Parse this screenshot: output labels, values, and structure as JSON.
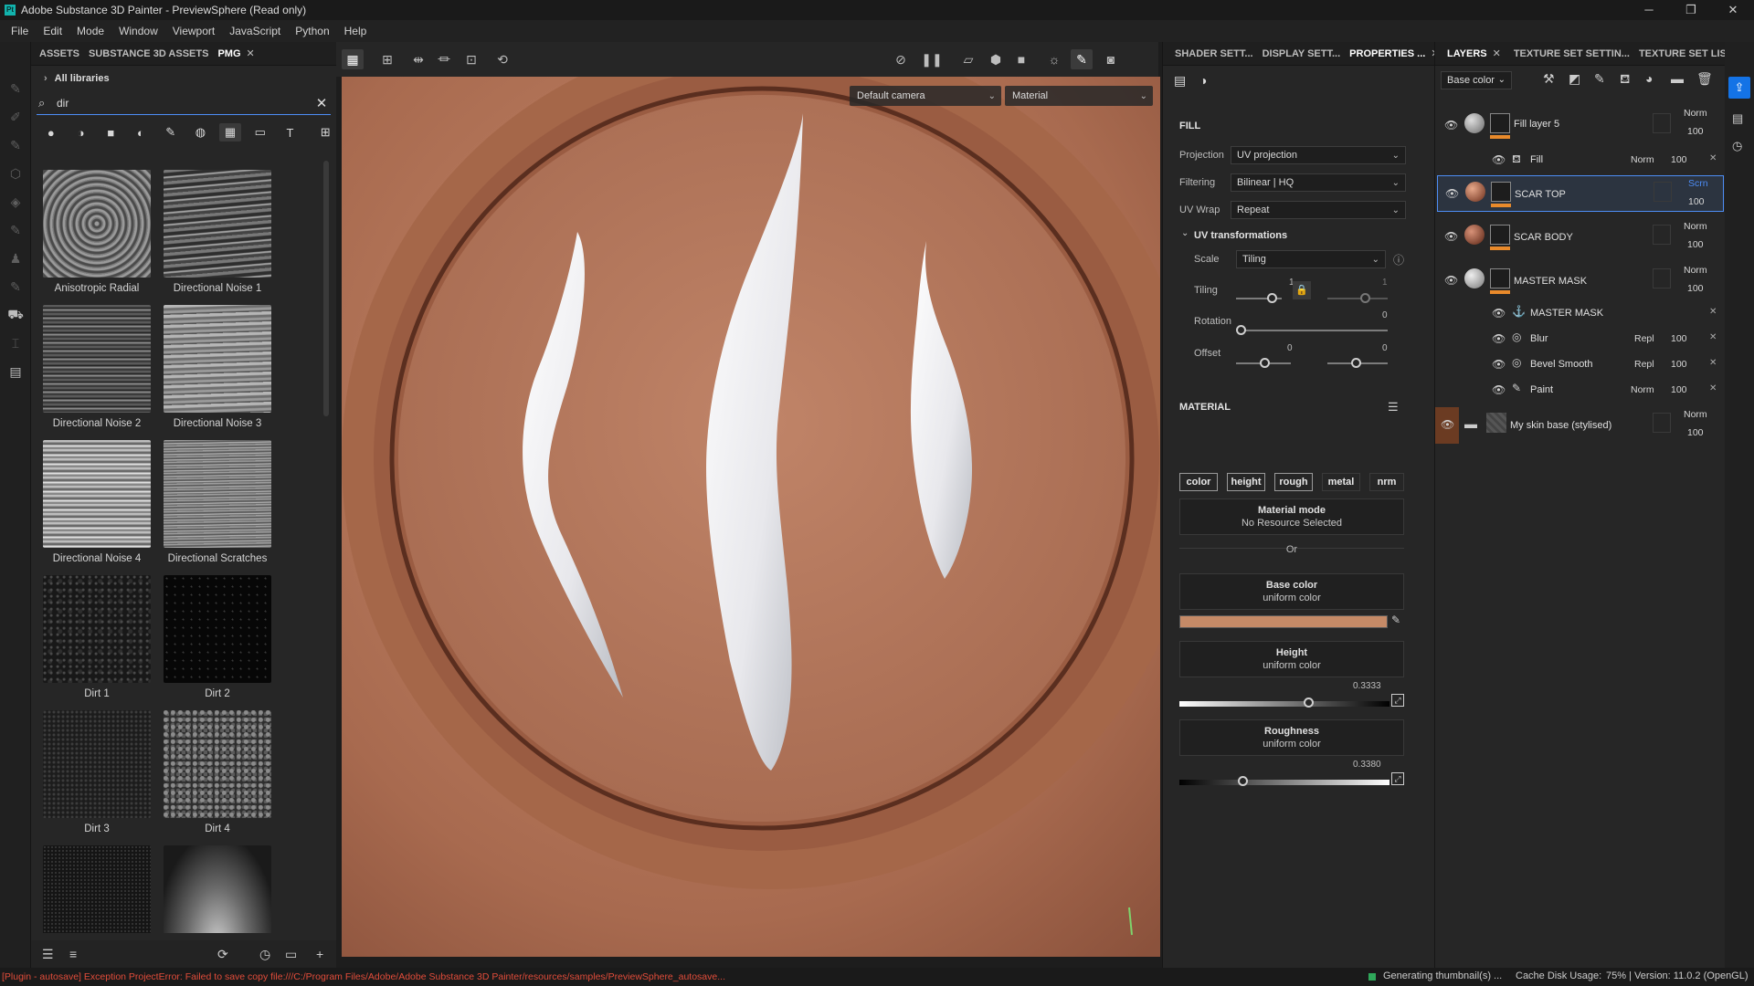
{
  "window": {
    "title": "Adobe Substance 3D Painter - PreviewSphere (Read only)",
    "app_icon": "Pt"
  },
  "menu": [
    "File",
    "Edit",
    "Mode",
    "Window",
    "Viewport",
    "JavaScript",
    "Python",
    "Help"
  ],
  "assets": {
    "tabs": [
      "ASSETS",
      "SUBSTANCE 3D ASSETS",
      "PMG"
    ],
    "breadcrumb": "All libraries",
    "search_value": "dir",
    "items": [
      "Anisotropic Radial",
      "Directional Noise 1",
      "Directional Noise 2",
      "Directional Noise 3",
      "Directional Noise 4",
      "Directional Scratches",
      "Dirt 1",
      "Dirt 2",
      "Dirt 3",
      "Dirt 4",
      "",
      ""
    ]
  },
  "viewport": {
    "camera_select": "Default camera",
    "mode_select": "Material"
  },
  "properties": {
    "tabs": [
      "SHADER SETT...",
      "DISPLAY SETT...",
      "PROPERTIES ..."
    ],
    "fill_title": "FILL",
    "projection_label": "Projection",
    "projection_value": "UV projection",
    "filtering_label": "Filtering",
    "filtering_value": "Bilinear | HQ",
    "uvwrap_label": "UV Wrap",
    "uvwrap_value": "Repeat",
    "uvtrans_title": "UV transformations",
    "scale_label": "Scale",
    "scale_value": "Tiling",
    "tiling_label": "Tiling",
    "tiling_v1": "1",
    "tiling_v2": "1",
    "rotation_label": "Rotation",
    "rotation_value": "0",
    "offset_label": "Offset",
    "offset_v1": "0",
    "offset_v2": "0",
    "material_title": "MATERIAL",
    "channels": [
      "color",
      "height",
      "rough",
      "metal",
      "nrm"
    ],
    "material_mode_title": "Material mode",
    "material_mode_sub": "No Resource Selected",
    "or": "Or",
    "base_color_title": "Base color",
    "base_color_sub": "uniform color",
    "base_color_hex": "#c58a67",
    "height_title": "Height",
    "height_sub": "uniform color",
    "height_value": "0.3333",
    "roughness_title": "Roughness",
    "roughness_sub": "uniform color",
    "roughness_value": "0.3380"
  },
  "layers": {
    "tabs": [
      "LAYERS",
      "TEXTURE SET SETTIN...",
      "TEXTURE SET LIST"
    ],
    "channel_select": "Base color",
    "items": [
      {
        "name": "Fill layer 5",
        "blend": "Norm",
        "opacity": "100"
      },
      {
        "name": "Fill",
        "blend": "Norm",
        "opacity": "100"
      },
      {
        "name": "SCAR TOP",
        "blend": "Scrn",
        "opacity": "100"
      },
      {
        "name": "SCAR BODY",
        "blend": "Norm",
        "opacity": "100"
      },
      {
        "name": "MASTER MASK",
        "blend": "Norm",
        "opacity": "100"
      },
      {
        "name": "MASTER MASK",
        "blend": "",
        "opacity": ""
      },
      {
        "name": "Blur",
        "blend": "Repl",
        "opacity": "100"
      },
      {
        "name": "Bevel Smooth",
        "blend": "Repl",
        "opacity": "100"
      },
      {
        "name": "Paint",
        "blend": "Norm",
        "opacity": "100"
      },
      {
        "name": "My skin base (stylised)",
        "blend": "Norm",
        "opacity": "100"
      }
    ]
  },
  "status": {
    "error": "[Plugin - autosave] Exception ProjectError: Failed to save copy file:///C:/Program Files/Adobe/Adobe Substance 3D Painter/resources/samples/PreviewSphere_autosave...",
    "generating": "Generating thumbnail(s) ...",
    "cache": "Cache Disk Usage:",
    "version": "75% | Version: 11.0.2 (OpenGL)"
  },
  "colors": {
    "accent": "#4d8df6",
    "orange": "#e98a2b",
    "error": "#e24c3a",
    "skin": "#b07256"
  }
}
